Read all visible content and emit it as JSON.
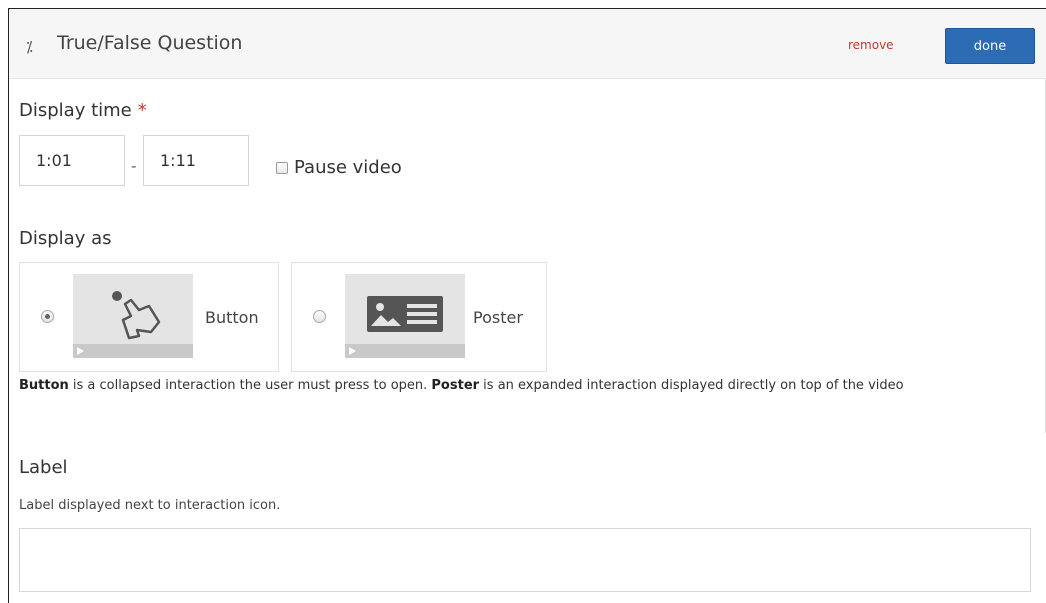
{
  "header": {
    "icon": "percent-icon",
    "title": "True/False Question",
    "remove_label": "remove",
    "done_label": "done"
  },
  "display_time": {
    "title": "Display time",
    "required_mark": "*",
    "start": "1:01",
    "separator": "-",
    "end": "1:11",
    "pause_label": "Pause video",
    "pause_checked": false
  },
  "display_as": {
    "title": "Display as",
    "options": [
      {
        "label": "Button",
        "icon": "pointing-hand-icon",
        "selected": true
      },
      {
        "label": "Poster",
        "icon": "image-text-icon",
        "selected": false
      }
    ],
    "description_parts": [
      "Button",
      " is a collapsed interaction the user must press to open. ",
      "Poster",
      " is an expanded interaction displayed directly on top of the video"
    ]
  },
  "label_section": {
    "title": "Label",
    "help": "Label displayed next to interaction icon.",
    "value": ""
  },
  "colors": {
    "done_button": "#2b6cb4",
    "remove_link": "#c0392b",
    "required": "#c0392b",
    "header_bg": "#f6f6f6"
  }
}
